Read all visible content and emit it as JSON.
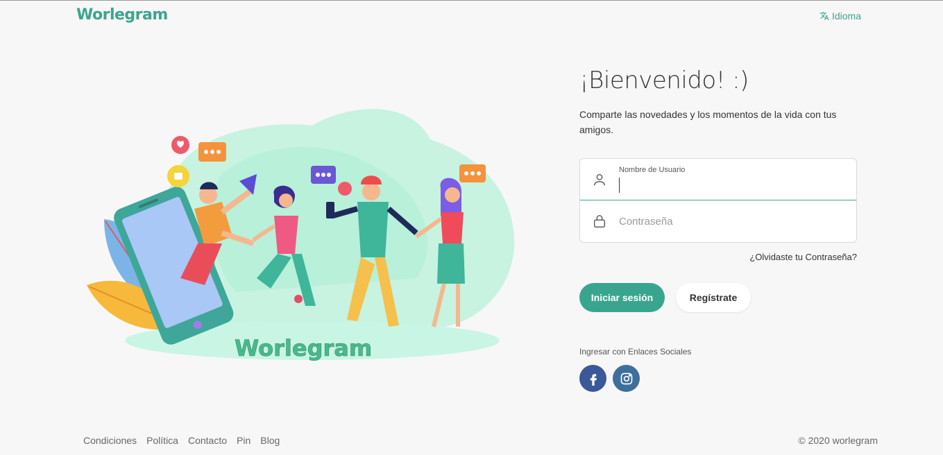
{
  "header": {
    "logo": "Worlegram",
    "language_label": "Idioma"
  },
  "illustration": {
    "brand_text": "Worlegram"
  },
  "login": {
    "title": "¡Bienvenido! :)",
    "subtitle": "Comparte las novedades y los momentos de la vida con tus amigos.",
    "username_label": "Nombre de Usuario",
    "username_value": "",
    "password_placeholder": "Contraseña",
    "forgot_password": "¿Olvidaste tu Contraseña?",
    "login_button": "Iniciar sesión",
    "register_button": "Regístrate",
    "social_label": "Ingresar con Enlaces Sociales",
    "social_icons": [
      "facebook-icon",
      "instagram-icon"
    ]
  },
  "footer": {
    "links": [
      "Condiciones",
      "Política",
      "Contacto",
      "Pin",
      "Blog"
    ],
    "copyright": "© 2020 worlegram"
  },
  "colors": {
    "accent": "#3aa58f",
    "facebook": "#3b5998",
    "instagram": "#3e6f9a",
    "background": "#f7f7f7"
  }
}
